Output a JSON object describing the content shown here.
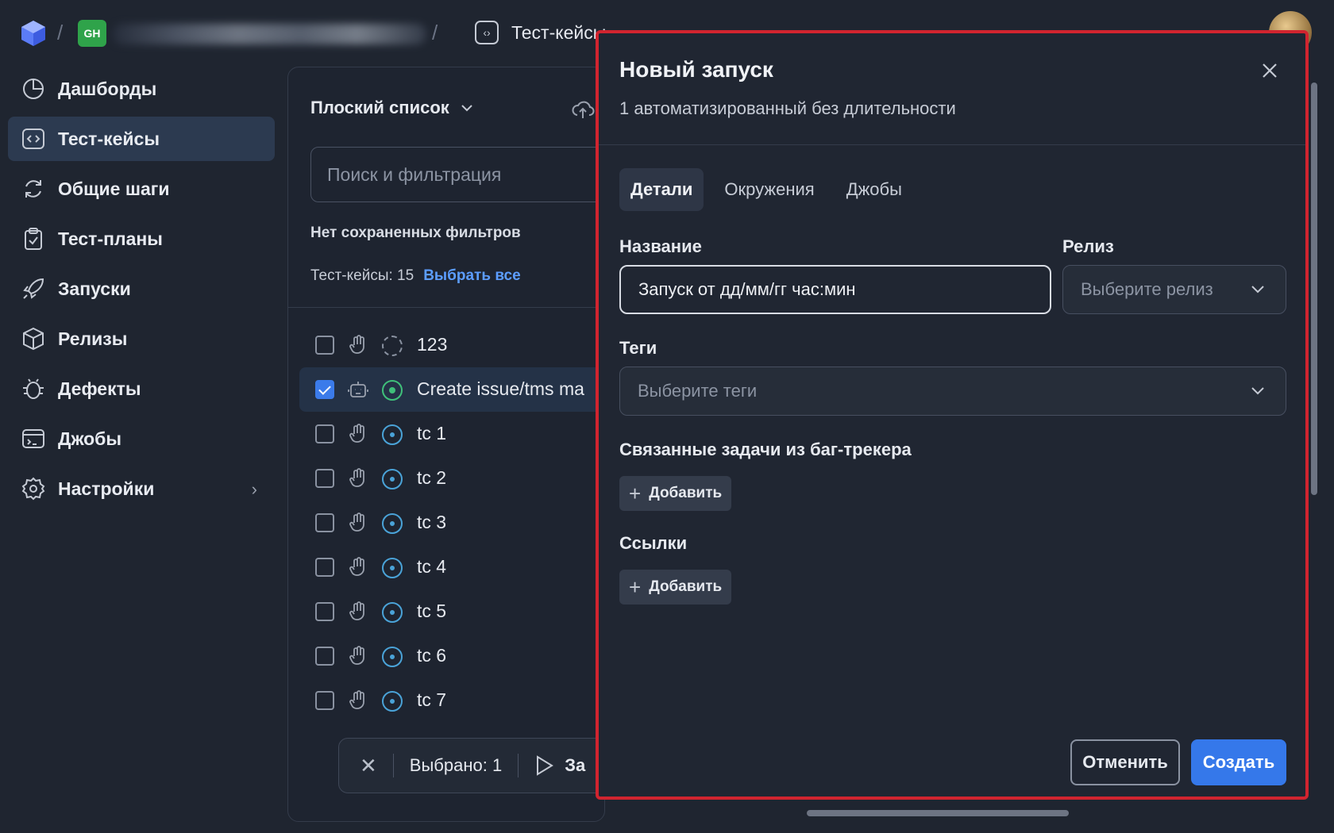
{
  "topbar": {
    "org_badge": "GH",
    "breadcrumb_current": "Тест-кейсы"
  },
  "sidebar": {
    "items": [
      {
        "label": "Дашборды",
        "icon": "pie-chart-icon"
      },
      {
        "label": "Тест-кейсы",
        "icon": "code-brackets-icon",
        "active": true
      },
      {
        "label": "Общие шаги",
        "icon": "refresh-icon"
      },
      {
        "label": "Тест-планы",
        "icon": "clipboard-check-icon"
      },
      {
        "label": "Запуски",
        "icon": "rocket-icon"
      },
      {
        "label": "Релизы",
        "icon": "package-icon"
      },
      {
        "label": "Дефекты",
        "icon": "bug-icon"
      },
      {
        "label": "Джобы",
        "icon": "terminal-icon"
      },
      {
        "label": "Настройки",
        "icon": "gear-icon",
        "has_submenu": true
      }
    ]
  },
  "list_panel": {
    "view_mode": "Плоский список",
    "search_placeholder": "Поиск и фильтрация",
    "no_filters": "Нет сохраненных фильтров",
    "count_label": "Тест-кейсы: 15",
    "select_all": "Выбрать все",
    "rows": [
      {
        "title": "123",
        "kind": "manual",
        "status": "draft",
        "checked": false
      },
      {
        "title": "Create issue/tms ma",
        "kind": "automated",
        "status": "active",
        "checked": true
      },
      {
        "title": "tc 1",
        "kind": "manual",
        "status": "review",
        "checked": false
      },
      {
        "title": "tc 2",
        "kind": "manual",
        "status": "review",
        "checked": false
      },
      {
        "title": "tc 3",
        "kind": "manual",
        "status": "review",
        "checked": false
      },
      {
        "title": "tc 4",
        "kind": "manual",
        "status": "review",
        "checked": false
      },
      {
        "title": "tc 5",
        "kind": "manual",
        "status": "review",
        "checked": false
      },
      {
        "title": "tc 6",
        "kind": "manual",
        "status": "review",
        "checked": false
      },
      {
        "title": "tc 7",
        "kind": "manual",
        "status": "review",
        "checked": false
      }
    ],
    "selection_bar": {
      "selected": "Выбрано: 1",
      "run_label": "За"
    }
  },
  "modal": {
    "title": "Новый запуск",
    "subtitle": "1 автоматизированный без длительности",
    "tabs": [
      "Детали",
      "Окружения",
      "Джобы"
    ],
    "active_tab": 0,
    "name_label": "Название",
    "name_value": "Запуск от дд/мм/гг час:мин",
    "release_label": "Релиз",
    "release_placeholder": "Выберите релиз",
    "tags_label": "Теги",
    "tags_placeholder": "Выберите теги",
    "issues_label": "Связанные задачи из баг-трекера",
    "links_label": "Ссылки",
    "add_label": "Добавить",
    "cancel": "Отменить",
    "create": "Создать"
  },
  "colors": {
    "background": "#1f2530",
    "accent": "#3578ea",
    "highlight_border": "#d1242f",
    "status_green": "#3fc07a",
    "status_blue": "#4aa3d8"
  }
}
